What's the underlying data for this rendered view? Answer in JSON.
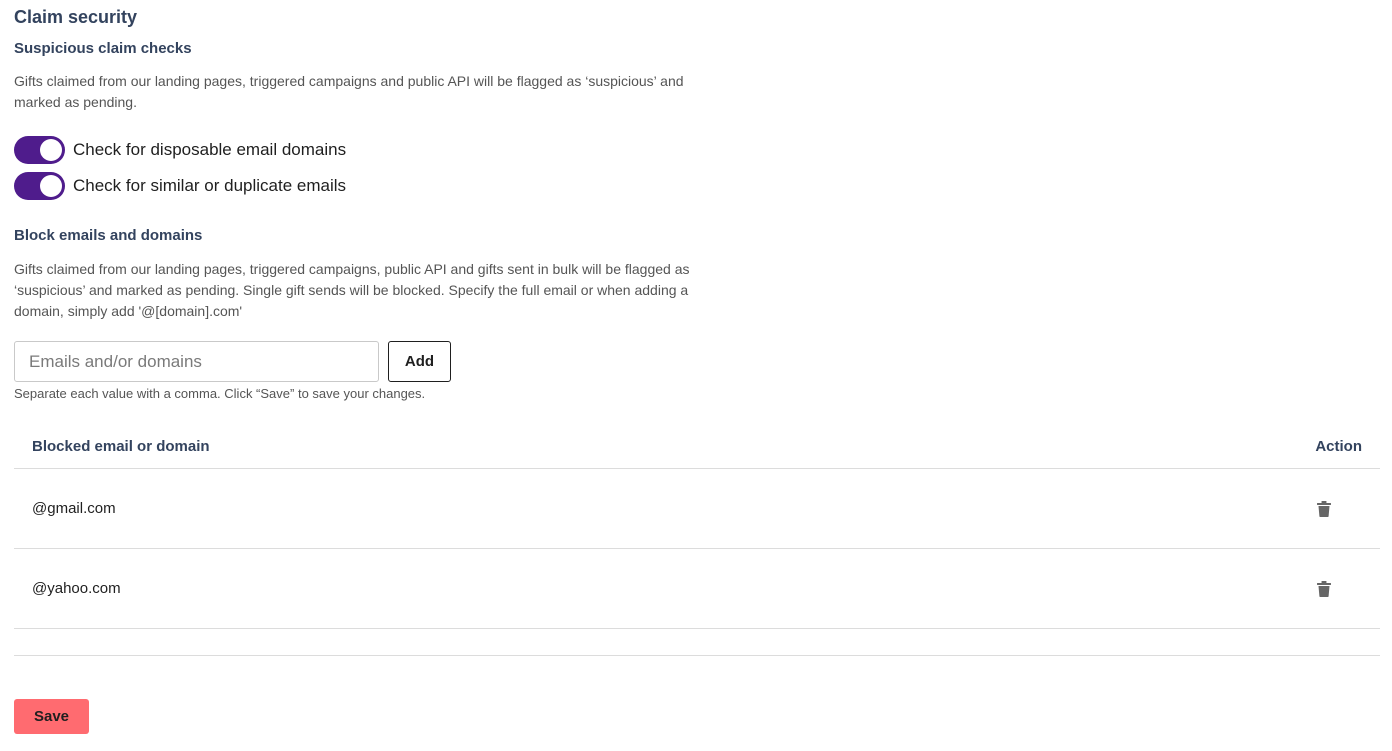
{
  "page_title": "Claim security",
  "suspicious": {
    "heading": "Suspicious claim checks",
    "description": "Gifts claimed from our landing pages, triggered campaigns and public API will be flagged as ‘suspicious’ and marked as pending.",
    "toggles": [
      {
        "label": "Check for disposable email domains",
        "enabled": true
      },
      {
        "label": "Check for similar or duplicate emails",
        "enabled": true
      }
    ]
  },
  "block": {
    "heading": "Block emails and domains",
    "description": "Gifts claimed from our landing pages, triggered campaigns, public API and gifts sent in bulk will be flagged as ‘suspicious’ and marked as pending. Single gift sends will be blocked. Specify the full email or when adding a domain, simply add '@[domain].com'",
    "input_placeholder": "Emails and/or domains",
    "input_value": "",
    "add_label": "Add",
    "help_text": "Separate each value with a comma. Click “Save” to save your changes."
  },
  "table": {
    "columns": [
      "Blocked email or domain",
      "Action"
    ],
    "rows": [
      {
        "value": "@gmail.com",
        "action_icon": "trash-icon"
      },
      {
        "value": "@yahoo.com",
        "action_icon": "trash-icon"
      }
    ]
  },
  "save_label": "Save",
  "colors": {
    "toggle_on": "#4f1c8c",
    "save_button": "#ff6b70",
    "heading": "#33435e"
  }
}
